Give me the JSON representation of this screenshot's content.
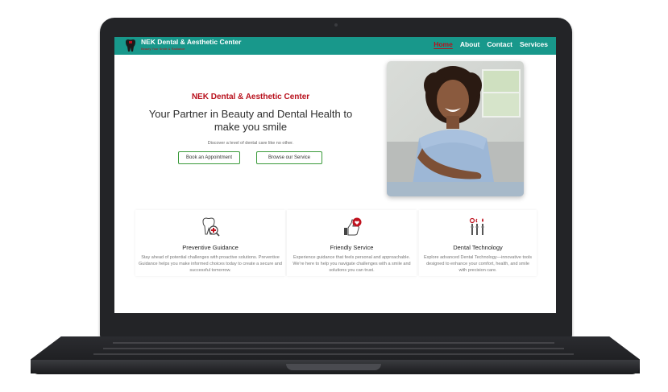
{
  "navbar": {
    "brand_name": "NEK Dental & Aesthetic Center",
    "brand_tagline": "Beauty Your Smile & Radiance",
    "links": [
      "Home",
      "About",
      "Contact",
      "Services"
    ],
    "active_link": "Home",
    "bg_color": "#18988b",
    "accent_color": "#b8101c"
  },
  "hero": {
    "org_name": "NEK Dental & Aesthetic Center",
    "title": "Your Partner in Beauty and Dental Health to make you smile",
    "subtitle": "Discover a level of dental care like no other.",
    "buttons": {
      "book": "Book an Appointment",
      "browse": "Browse our Service"
    }
  },
  "features": [
    {
      "title": "Preventive Guidance",
      "icon": "tooth-magnifier-icon",
      "text": "Stay ahead of potential challenges with proactive solutions. Preventive Guidance helps you make informed choices today to create a secure and successful tomorrow."
    },
    {
      "title": "Friendly Service",
      "icon": "thumbs-up-heart-icon",
      "text": "Experience guidance that feels personal and approachable. We're here to help you navigate challenges with a smile and solutions you can trust."
    },
    {
      "title": "Dental Technology",
      "icon": "dental-instruments-icon",
      "text": "Explore advanced Dental Technology—innovative tools designed to enhance your comfort, health, and smile with precision care."
    }
  ]
}
